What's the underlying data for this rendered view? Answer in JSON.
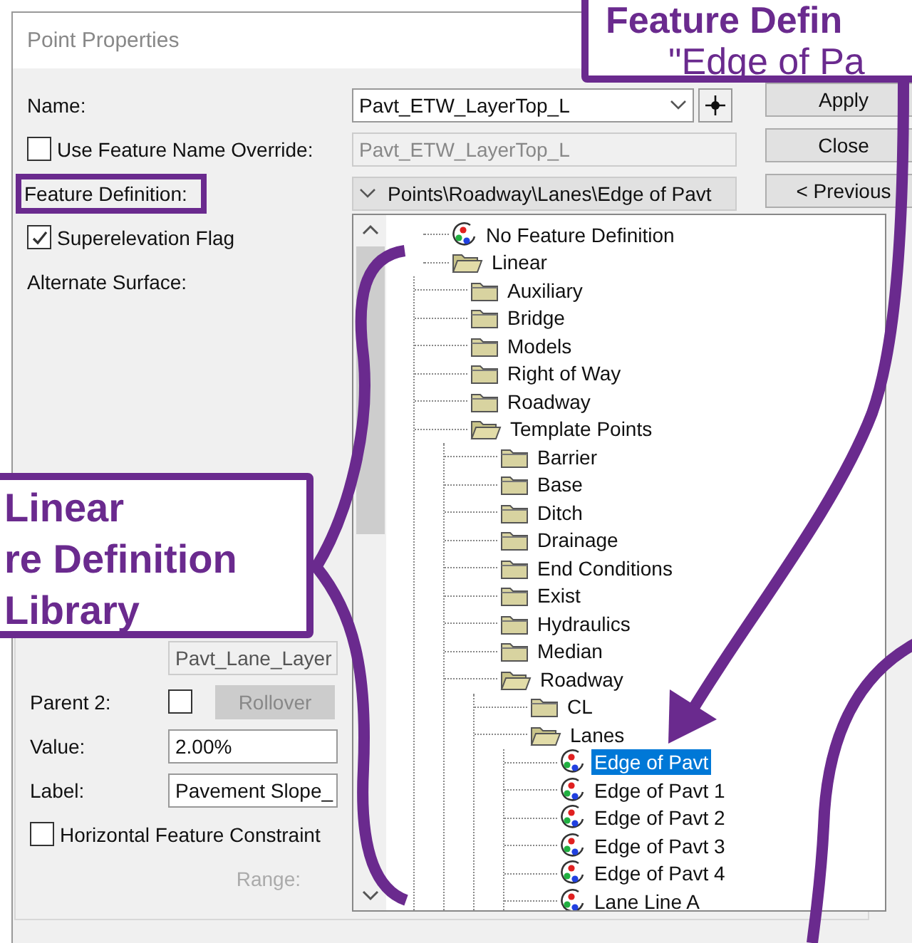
{
  "window": {
    "title": "Point Properties"
  },
  "name_field": {
    "label": "Name:",
    "value": "Pavt_ETW_LayerTop_L"
  },
  "override": {
    "label": "Use Feature Name Override:",
    "checked": false,
    "value": "Pavt_ETW_LayerTop_L"
  },
  "feature_definition": {
    "label": "Feature Definition:",
    "value": "Points\\Roadway\\Lanes\\Edge of Pavt",
    "expanded": true
  },
  "superelevation": {
    "label": "Superelevation Flag",
    "checked": true
  },
  "alternate_surface": {
    "label": "Alternate Surface:"
  },
  "parent_field": {
    "value": "Pavt_Lane_Layer"
  },
  "parent2": {
    "label": "Parent 2:",
    "checked": false,
    "button": "Rollover"
  },
  "value_field": {
    "label": "Value:",
    "value": "2.00%"
  },
  "label_field": {
    "label": "Label:",
    "value": "Pavement Slope_"
  },
  "horizontal_constraint": {
    "label": "Horizontal Feature Constraint",
    "checked": false
  },
  "range": {
    "label": "Range:"
  },
  "buttons": [
    "Apply",
    "Close",
    "< Previous"
  ],
  "tree": [
    {
      "label": "No Feature Definition",
      "kind": "feature",
      "selected": false
    },
    {
      "label": "Linear",
      "kind": "folder",
      "expanded": true,
      "selected": false,
      "children": [
        {
          "label": "Auxiliary",
          "kind": "folder",
          "expanded": false,
          "selected": false
        },
        {
          "label": "Bridge",
          "kind": "folder",
          "expanded": false,
          "selected": false
        },
        {
          "label": "Models",
          "kind": "folder",
          "expanded": false,
          "selected": false
        },
        {
          "label": "Right of Way",
          "kind": "folder",
          "expanded": false,
          "selected": false
        },
        {
          "label": "Roadway",
          "kind": "folder",
          "expanded": false,
          "selected": false
        },
        {
          "label": "Template Points",
          "kind": "folder",
          "expanded": true,
          "selected": false,
          "children": [
            {
              "label": "Barrier",
              "kind": "folder",
              "expanded": false,
              "selected": false
            },
            {
              "label": "Base",
              "kind": "folder",
              "expanded": false,
              "selected": false
            },
            {
              "label": "Ditch",
              "kind": "folder",
              "expanded": false,
              "selected": false
            },
            {
              "label": "Drainage",
              "kind": "folder",
              "expanded": false,
              "selected": false
            },
            {
              "label": "End Conditions",
              "kind": "folder",
              "expanded": false,
              "selected": false
            },
            {
              "label": "Exist",
              "kind": "folder",
              "expanded": false,
              "selected": false
            },
            {
              "label": "Hydraulics",
              "kind": "folder",
              "expanded": false,
              "selected": false
            },
            {
              "label": "Median",
              "kind": "folder",
              "expanded": false,
              "selected": false
            },
            {
              "label": "Roadway",
              "kind": "folder",
              "expanded": true,
              "selected": false,
              "children": [
                {
                  "label": "CL",
                  "kind": "folder",
                  "expanded": false,
                  "selected": false
                },
                {
                  "label": "Lanes",
                  "kind": "folder",
                  "expanded": true,
                  "selected": false,
                  "children": [
                    {
                      "label": "Edge of Pavt",
                      "kind": "feature",
                      "selected": true
                    },
                    {
                      "label": "Edge of Pavt 1",
                      "kind": "feature",
                      "selected": false
                    },
                    {
                      "label": "Edge of Pavt 2",
                      "kind": "feature",
                      "selected": false
                    },
                    {
                      "label": "Edge of Pavt 3",
                      "kind": "feature",
                      "selected": false
                    },
                    {
                      "label": "Edge of Pavt 4",
                      "kind": "feature",
                      "selected": false
                    },
                    {
                      "label": "Lane Line A",
                      "kind": "feature",
                      "selected": false
                    }
                  ]
                }
              ]
            }
          ]
        }
      ]
    }
  ],
  "callouts": [
    {
      "kind": "top",
      "lines": [
        "Feature Defin",
        "\"Edge of Pa"
      ]
    },
    {
      "kind": "left",
      "lines": [
        "Linear",
        "re Definition",
        "Library"
      ]
    }
  ]
}
